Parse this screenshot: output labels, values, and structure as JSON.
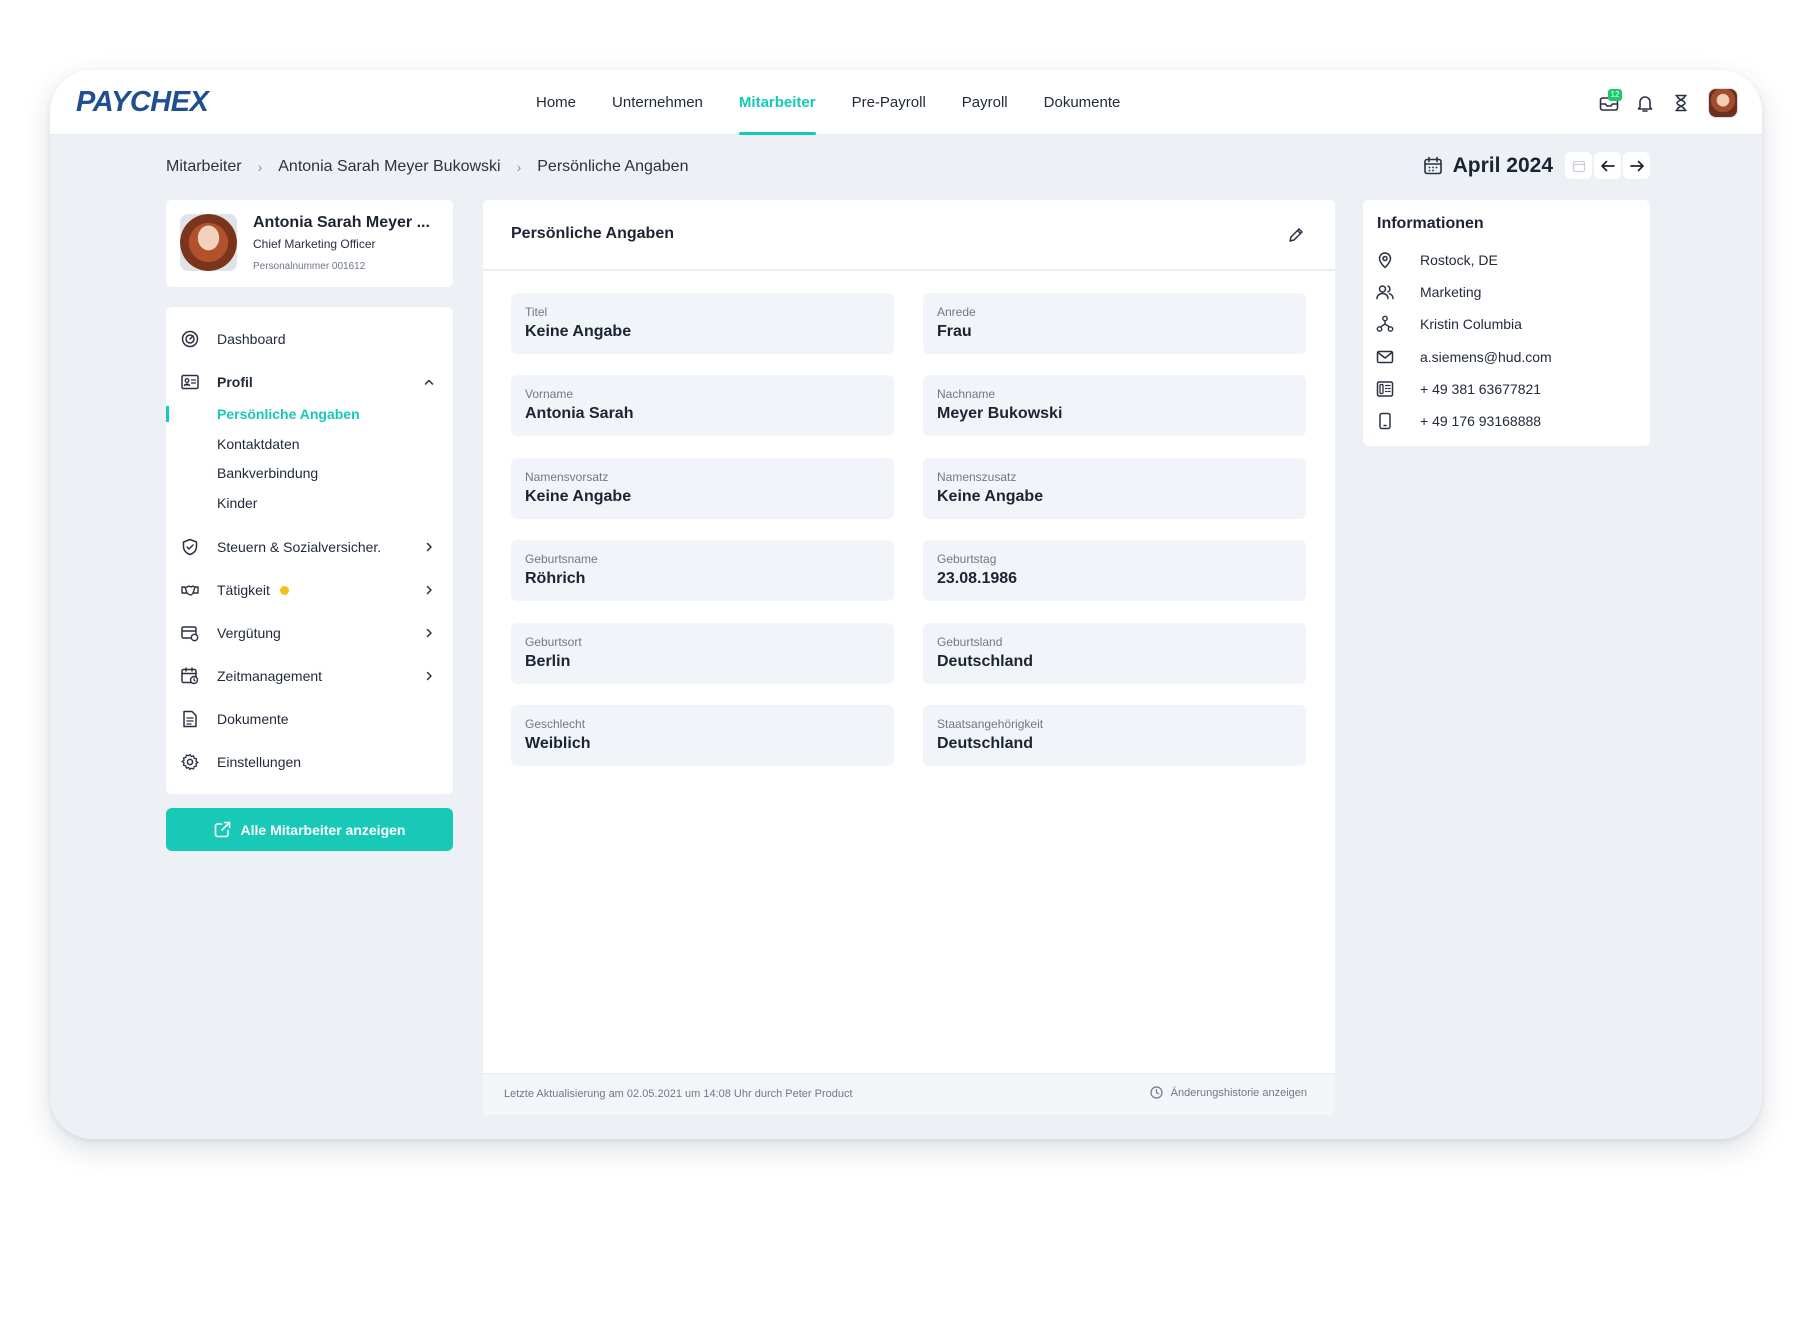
{
  "brand": {
    "logo_text": "PAYCHEX",
    "accent": "#16c8b7",
    "logo_color": "#1f4e93"
  },
  "topnav": {
    "items": [
      {
        "label": "Home",
        "active": false
      },
      {
        "label": "Unternehmen",
        "active": false
      },
      {
        "label": "Mitarbeiter",
        "active": true
      },
      {
        "label": "Pre-Payroll",
        "active": false
      },
      {
        "label": "Payroll",
        "active": false
      },
      {
        "label": "Dokumente",
        "active": false
      }
    ],
    "inbox_badge": "12",
    "icons": [
      "inbox-icon",
      "bell-icon",
      "hourglass-icon"
    ]
  },
  "breadcrumb": {
    "items": [
      "Mitarbeiter",
      "Antonia Sarah Meyer Bukowski",
      "Persönliche Angaben"
    ]
  },
  "period": {
    "label": "April 2024"
  },
  "profile": {
    "name": "Antonia Sarah Meyer ...",
    "role": "Chief Marketing Officer",
    "personnel_number": "Personalnummer 001612"
  },
  "sidebar": {
    "items": [
      {
        "label": "Dashboard",
        "icon": "dashboard-icon"
      },
      {
        "label": "Profil",
        "icon": "profile-card-icon",
        "expanded": true
      },
      {
        "label": "Steuern & Sozialversicher.",
        "icon": "shield-icon"
      },
      {
        "label": "Tätigkeit",
        "icon": "handshake-icon",
        "warning": true
      },
      {
        "label": "Vergütung",
        "icon": "payment-icon"
      },
      {
        "label": "Zeitmanagement",
        "icon": "calendar-clock-icon"
      },
      {
        "label": "Dokumente",
        "icon": "document-icon"
      },
      {
        "label": "Einstellungen",
        "icon": "settings-icon"
      }
    ],
    "profile_sub": [
      {
        "label": "Persönliche Angaben",
        "active": true
      },
      {
        "label": "Kontaktdaten",
        "active": false
      },
      {
        "label": "Bankverbindung",
        "active": false
      },
      {
        "label": "Kinder",
        "active": false
      }
    ],
    "all_button": "Alle Mitarbeiter anzeigen"
  },
  "main": {
    "title": "Persönliche Angaben",
    "fields": [
      {
        "label": "Titel",
        "value": "Keine Angabe"
      },
      {
        "label": "Anrede",
        "value": "Frau"
      },
      {
        "label": "Vorname",
        "value": "Antonia Sarah"
      },
      {
        "label": "Nachname",
        "value": "Meyer Bukowski"
      },
      {
        "label": "Namensvorsatz",
        "value": "Keine Angabe"
      },
      {
        "label": "Namenszusatz",
        "value": "Keine Angabe"
      },
      {
        "label": "Geburtsname",
        "value": "Röhrich"
      },
      {
        "label": "Geburtstag",
        "value": "23.08.1986"
      },
      {
        "label": "Geburtsort",
        "value": "Berlin"
      },
      {
        "label": "Geburtsland",
        "value": "Deutschland"
      },
      {
        "label": "Geschlecht",
        "value": "Weiblich"
      },
      {
        "label": "Staatsangehörigkeit",
        "value": "Deutschland"
      }
    ],
    "footer_text": "Letzte Aktualisierung am 02.05.2021 um 14:08 Uhr durch Peter Product",
    "history_link": "Änderungshistorie anzeigen"
  },
  "info": {
    "title": "Informationen",
    "rows": [
      {
        "text": "Rostock, DE",
        "icon": "location-pin-icon"
      },
      {
        "text": "Marketing",
        "icon": "team-icon"
      },
      {
        "text": "Kristin Columbia",
        "icon": "org-chart-icon"
      },
      {
        "text": "a.siemens@hud.com",
        "icon": "mail-icon"
      },
      {
        "text": "+ 49 381 63677821",
        "icon": "phone-icon"
      },
      {
        "text": "+ 49 176 93168888",
        "icon": "mobile-icon"
      }
    ]
  }
}
